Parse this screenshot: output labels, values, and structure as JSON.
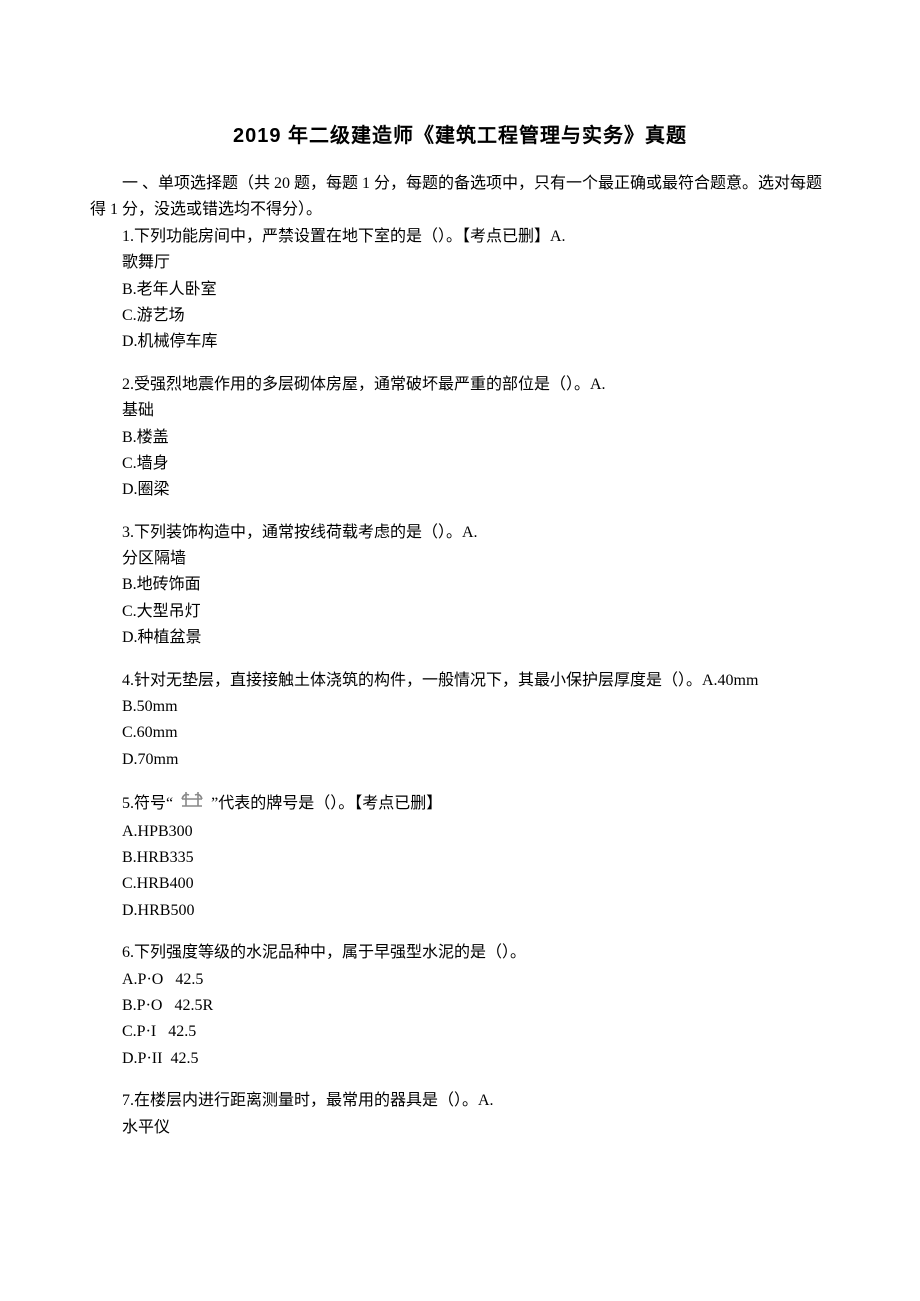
{
  "title": "2019 年二级建造师《建筑工程管理与实务》真题",
  "intro": "一 、单项选择题（共 20 题，每题 1 分，每题的备选项中，只有一个最正确或最符合题意。选对每题得 1 分，没选或错选均不得分）。",
  "q1": {
    "stem": "1.下列功能房间中，严禁设置在地下室的是（）。【考点已删】A.",
    "a_tail": "歌舞厅",
    "b": "B.老年人卧室",
    "c": "C.游艺场",
    "d": "D.机械停车库"
  },
  "q2": {
    "stem": "2.受强烈地震作用的多层砌体房屋，通常破坏最严重的部位是（）。A.",
    "a_tail": "基础",
    "b": "B.楼盖",
    "c": "C.墙身",
    "d": "D.圈梁"
  },
  "q3": {
    "stem": "3.下列装饰构造中，通常按线荷载考虑的是（）。A.",
    "a_tail": "分区隔墙",
    "b": "B.地砖饰面",
    "c": "C.大型吊灯",
    "d": "D.种植盆景"
  },
  "q4": {
    "stem": "4.针对无垫层，直接接触土体浇筑的构件，一般情况下，其最小保护层厚度是（）。A.40mm",
    "b": "B.50mm",
    "c": "C.60mm",
    "d": "D.70mm"
  },
  "q5": {
    "prefix": "5.符号“",
    "suffix": "”代表的牌号是（）。【考点已删】",
    "a": "A.HPB300",
    "b": "B.HRB335",
    "c": "C.HRB400",
    "d": "D.HRB500"
  },
  "q6": {
    "stem": "6.下列强度等级的水泥品种中，属于早强型水泥的是（）。",
    "a": "A.P·O   42.5",
    "b": "B.P·O   42.5R",
    "c": "C.P·I   42.5",
    "d": "D.P·II  42.5"
  },
  "q7": {
    "stem": "7.在楼层内进行距离测量时，最常用的器具是（）。A.",
    "a_tail": "水平仪"
  }
}
